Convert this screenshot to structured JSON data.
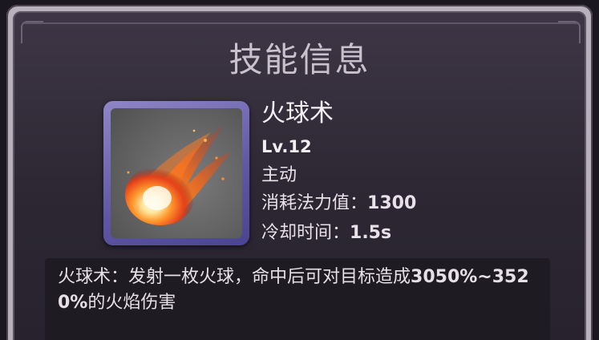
{
  "panel": {
    "title": "技能信息"
  },
  "skill": {
    "icon": "fireball-icon",
    "name": "火球术",
    "level": "Lv.12",
    "type": "主动",
    "cost_label": "消耗法力值：",
    "cost_value": "1300",
    "cooldown_label": "冷却时间：",
    "cooldown_value": "1.5s"
  },
  "description": {
    "prefix": "火球术：发射一枚火球，命中后可对目标造成",
    "damage_range": "3050%~3520%",
    "suffix": "的火焰伤害"
  },
  "colors": {
    "frame": "#5f57a3",
    "panel_bg": "#2c2733",
    "text": "#e8e2e8"
  }
}
